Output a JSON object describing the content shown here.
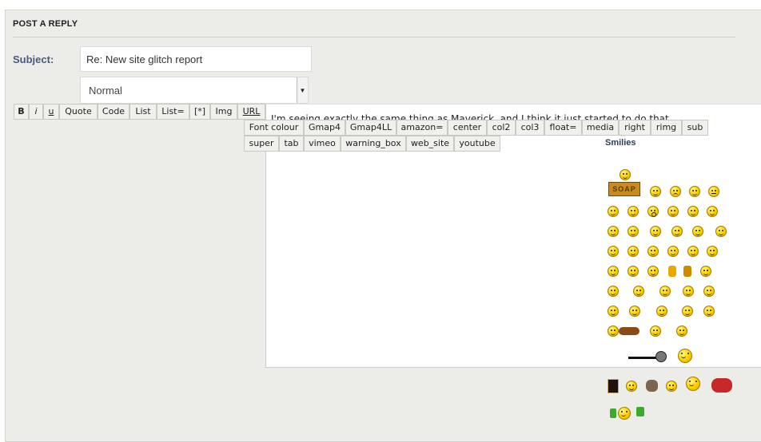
{
  "panel": {
    "title": "POST A REPLY"
  },
  "subject": {
    "label": "Subject:",
    "value": "Re: New site glitch report"
  },
  "font_size_select": {
    "value": "Normal"
  },
  "toolbar_row1": [
    {
      "label": "B"
    },
    {
      "label": "i"
    },
    {
      "label": "u"
    },
    {
      "label": "Quote"
    },
    {
      "label": "Code"
    },
    {
      "label": "List"
    },
    {
      "label": "List="
    },
    {
      "label": "[*]"
    },
    {
      "label": "Img"
    },
    {
      "label": "URL"
    }
  ],
  "toolbar_row2": [
    {
      "label": "Font colour"
    },
    {
      "label": "Gmap4"
    },
    {
      "label": "Gmap4LL"
    },
    {
      "label": "amazon="
    },
    {
      "label": "center"
    },
    {
      "label": "col2"
    },
    {
      "label": "col3"
    },
    {
      "label": "float="
    },
    {
      "label": "media"
    },
    {
      "label": "right"
    },
    {
      "label": "rimg"
    },
    {
      "label": "sub"
    }
  ],
  "toolbar_row3": [
    {
      "label": "super"
    },
    {
      "label": "tab"
    },
    {
      "label": "vimeo"
    },
    {
      "label": "warning_box"
    },
    {
      "label": "web_site"
    },
    {
      "label": "youtube"
    }
  ],
  "editor": {
    "text": "I'm seeing exactly the same thing as Maverick, and I think it just started to do that."
  },
  "smilies": {
    "title": "Smilies",
    "soap_text": "SOAP"
  },
  "colors": {
    "panel_bg": "#ecece8",
    "label": "#4a5a7a",
    "smiley_yellow": "#ffd700"
  }
}
